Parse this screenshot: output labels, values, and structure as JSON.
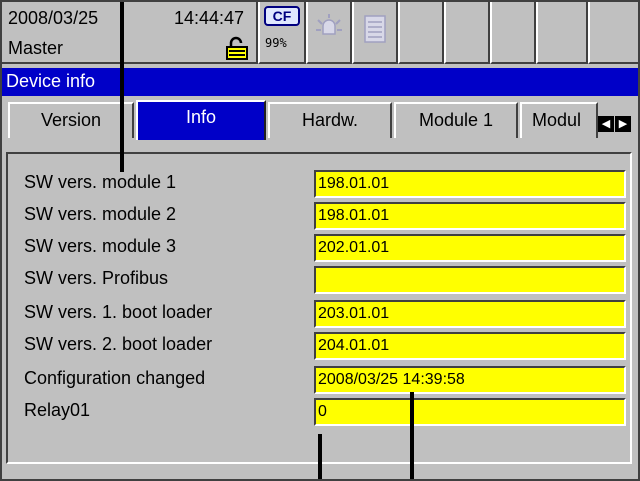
{
  "status_bar": {
    "date": "2008/03/25",
    "time": "14:44:47",
    "user": "Master",
    "cf_label": "CF",
    "cf_percent": "99%",
    "icons": [
      "lock-open-icon",
      "alarm-bell-icon",
      "list-icon"
    ]
  },
  "title": "Device info",
  "tabs": [
    {
      "label": "Version",
      "active": false
    },
    {
      "label": "Info",
      "active": true
    },
    {
      "label": "Hardw.",
      "active": false
    },
    {
      "label": "Module 1",
      "active": false
    },
    {
      "label": "Modul",
      "active": false
    }
  ],
  "rows": [
    {
      "label": "SW vers. module 1",
      "value": "198.01.01"
    },
    {
      "label": "SW vers. module 2",
      "value": "198.01.01"
    },
    {
      "label": "SW vers. module 3",
      "value": "202.01.01"
    },
    {
      "label": "SW vers. Profibus",
      "value": ""
    },
    {
      "label": "SW vers. 1. boot loader",
      "value": "203.01.01"
    },
    {
      "label": "SW vers. 2. boot loader",
      "value": "204.01.01"
    },
    {
      "label": "Configuration changed",
      "value": "2008/03/25 14:39:58"
    },
    {
      "label": "Relay01",
      "value": "0"
    }
  ],
  "colors": {
    "accent": "#0000c8",
    "field": "#ffff00",
    "panel": "#c0c0c0"
  }
}
